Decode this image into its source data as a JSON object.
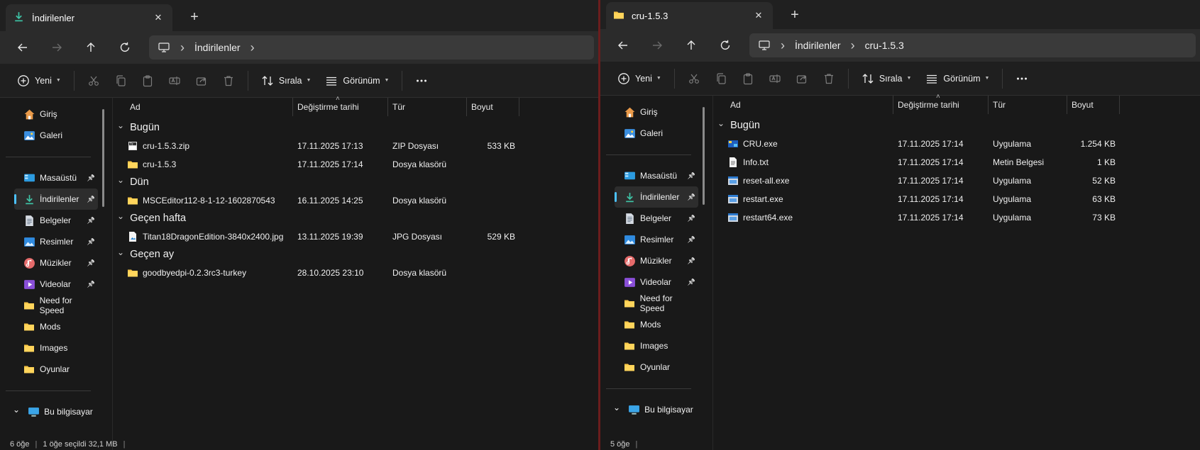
{
  "left": {
    "tab_title": "İndirilenler",
    "address": [
      "İndirilenler"
    ],
    "toolbar": {
      "new": "Yeni",
      "sort": "Sırala",
      "view": "Görünüm"
    },
    "sidebar": {
      "top": [
        {
          "label": "Giriş",
          "icon": "home-icon"
        },
        {
          "label": "Galeri",
          "icon": "gallery-icon"
        }
      ],
      "pinned": [
        {
          "label": "Masaüstü",
          "icon": "desktop-icon"
        },
        {
          "label": "İndirilenler",
          "icon": "download-icon"
        },
        {
          "label": "Belgeler",
          "icon": "documents-icon"
        },
        {
          "label": "Resimler",
          "icon": "pictures-icon"
        },
        {
          "label": "Müzikler",
          "icon": "music-icon"
        },
        {
          "label": "Videolar",
          "icon": "videos-icon"
        }
      ],
      "folders": [
        "Need for Speed",
        "Mods",
        "Images",
        "Oyunlar"
      ],
      "this_pc": "Bu bilgisayar"
    },
    "columns": {
      "name": "Ad",
      "date": "Değiştirme tarihi",
      "type": "Tür",
      "size": "Boyut"
    },
    "groups": [
      {
        "label": "Bugün",
        "items": [
          {
            "name": "cru-1.5.3.zip",
            "date": "17.11.2025 17:13",
            "type": "ZIP Dosyası",
            "size": "533 KB",
            "icon": "zip-icon"
          },
          {
            "name": "cru-1.5.3",
            "date": "17.11.2025 17:14",
            "type": "Dosya klasörü",
            "size": "",
            "icon": "folder-icon"
          }
        ]
      },
      {
        "label": "Dün",
        "items": [
          {
            "name": "MSCEditor112-8-1-12-1602870543",
            "date": "16.11.2025 14:25",
            "type": "Dosya klasörü",
            "size": "",
            "icon": "folder-icon"
          }
        ]
      },
      {
        "label": "Geçen hafta",
        "items": [
          {
            "name": "Titan18DragonEdition-3840x2400.jpg",
            "date": "13.11.2025 19:39",
            "type": "JPG Dosyası",
            "size": "529 KB",
            "icon": "image-file-icon"
          }
        ]
      },
      {
        "label": "Geçen ay",
        "items": [
          {
            "name": "goodbyedpi-0.2.3rc3-turkey",
            "date": "28.10.2025 23:10",
            "type": "Dosya klasörü",
            "size": "",
            "icon": "folder-icon"
          }
        ]
      }
    ],
    "status": {
      "count": "6 öğe",
      "selected": "1 öğe seçildi  32,1 MB"
    }
  },
  "right": {
    "tab_title": "cru-1.5.3",
    "address": [
      "İndirilenler",
      "cru-1.5.3"
    ],
    "toolbar": {
      "new": "Yeni",
      "sort": "Sırala",
      "view": "Görünüm"
    },
    "sidebar": {
      "top": [
        {
          "label": "Giriş",
          "icon": "home-icon"
        },
        {
          "label": "Galeri",
          "icon": "gallery-icon"
        }
      ],
      "pinned": [
        {
          "label": "Masaüstü",
          "icon": "desktop-icon"
        },
        {
          "label": "İndirilenler",
          "icon": "download-icon"
        },
        {
          "label": "Belgeler",
          "icon": "documents-icon"
        },
        {
          "label": "Resimler",
          "icon": "pictures-icon"
        },
        {
          "label": "Müzikler",
          "icon": "music-icon"
        },
        {
          "label": "Videolar",
          "icon": "videos-icon"
        }
      ],
      "folders": [
        "Need for Speed",
        "Mods",
        "Images",
        "Oyunlar"
      ],
      "this_pc": "Bu bilgisayar"
    },
    "columns": {
      "name": "Ad",
      "date": "Değiştirme tarihi",
      "type": "Tür",
      "size": "Boyut"
    },
    "groups": [
      {
        "label": "Bugün",
        "items": [
          {
            "name": "CRU.exe",
            "date": "17.11.2025 17:14",
            "type": "Uygulama",
            "size": "1.254 KB",
            "icon": "app-icon"
          },
          {
            "name": "Info.txt",
            "date": "17.11.2025 17:14",
            "type": "Metin Belgesi",
            "size": "1 KB",
            "icon": "text-file-icon"
          },
          {
            "name": "reset-all.exe",
            "date": "17.11.2025 17:14",
            "type": "Uygulama",
            "size": "52 KB",
            "icon": "exe-icon"
          },
          {
            "name": "restart.exe",
            "date": "17.11.2025 17:14",
            "type": "Uygulama",
            "size": "63 KB",
            "icon": "exe-icon"
          },
          {
            "name": "restart64.exe",
            "date": "17.11.2025 17:14",
            "type": "Uygulama",
            "size": "73 KB",
            "icon": "exe-icon"
          }
        ]
      }
    ],
    "status": {
      "count": "5 öğe",
      "selected": ""
    }
  },
  "colors": {
    "accent": "#4cc2ff",
    "folder": "#f5c243",
    "background": "#191919"
  }
}
